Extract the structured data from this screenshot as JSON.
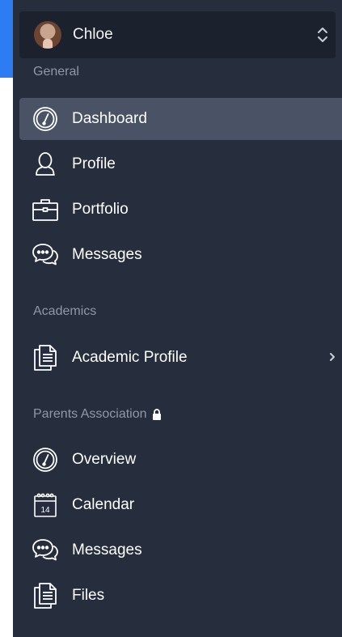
{
  "account": {
    "name": "Chloe",
    "avatar_icon": "user-avatar-icon",
    "switcher_icon": "chevron-up-down-icon"
  },
  "sections": {
    "general": "General",
    "academics": "Academics",
    "parents": "Parents Association"
  },
  "general_items": [
    {
      "label": "Dashboard",
      "icon": "dashboard-gauge-icon",
      "active": true
    },
    {
      "label": "Profile",
      "icon": "user-icon"
    },
    {
      "label": "Portfolio",
      "icon": "briefcase-icon"
    },
    {
      "label": "Messages",
      "icon": "chat-bubbles-icon"
    }
  ],
  "academics_items": [
    {
      "label": "Academic Profile",
      "icon": "documents-icon",
      "has_submenu": true
    }
  ],
  "parents_items": [
    {
      "label": "Overview",
      "icon": "dashboard-gauge-icon"
    },
    {
      "label": "Calendar",
      "icon": "calendar-icon",
      "calendar_day": "14"
    },
    {
      "label": "Messages",
      "icon": "chat-bubbles-icon"
    },
    {
      "label": "Files",
      "icon": "documents-icon"
    }
  ],
  "colors": {
    "sidebar_bg": "#262d3c",
    "account_bg": "#1b212d",
    "active_bg": "#4a5366",
    "section_label": "#8f98a9",
    "top_blue": "#2e7cf3"
  }
}
